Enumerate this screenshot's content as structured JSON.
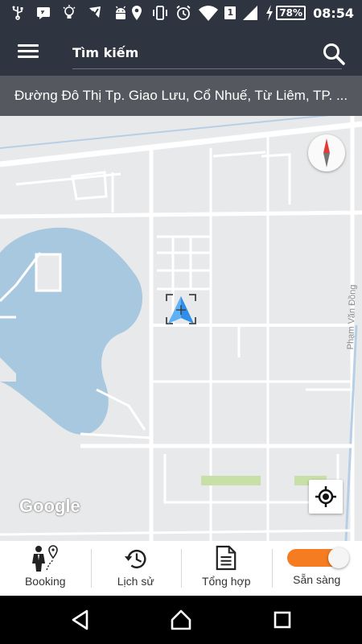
{
  "status_bar": {
    "time": "08:54",
    "battery_percent": "78%",
    "notification_badge": "1",
    "left_icons": [
      "usb-icon",
      "message-icon",
      "lightbulb-icon",
      "check-shield-icon",
      "android-icon"
    ],
    "right_icons": [
      "location-pin-icon",
      "vibrate-icon",
      "alarm-icon",
      "wifi-icon",
      "signal-icon",
      "charging-icon"
    ]
  },
  "app_bar": {
    "search_placeholder": "Tìm kiếm",
    "menu_icon": "hamburger-menu-icon",
    "search_icon": "search-icon"
  },
  "address": {
    "text": "Đường Đô Thị Tp. Giao Lưu, Cổ Nhuế, Từ Liêm, TP. ..."
  },
  "map": {
    "road_label": "Phạm Văn Đồng",
    "logo": "Google",
    "water_color": "#a8c8e0",
    "road_color": "#ffffff",
    "land_color": "#e8e9ea",
    "park_color": "#c8dfa8"
  },
  "bottom_nav": {
    "items": [
      {
        "label": "Booking",
        "icon": "booking-person-icon"
      },
      {
        "label": "Lịch sử",
        "icon": "history-icon"
      },
      {
        "label": "Tổng hợp",
        "icon": "document-icon"
      },
      {
        "label": "Sẵn sàng",
        "icon": "ready-toggle",
        "toggle_on": true
      }
    ]
  },
  "colors": {
    "header_bg": "#2e3440",
    "address_bg": "#55585e",
    "accent_orange": "#f57c20",
    "marker_blue": "#2f8fe8"
  }
}
